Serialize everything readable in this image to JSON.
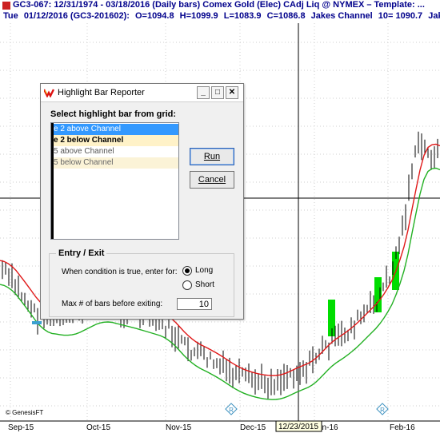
{
  "header": {
    "title": "GC3-067:  12/31/1974 - 03/18/2016  (Daily bars)   Comex Gold (Elec) CAdj Liq @ NYMEX  –  Template: ...",
    "info": [
      "Tue",
      "01/12/2016 (GC3-201602):",
      "O=1094.8",
      "H=1099.9",
      "L=1083.9",
      "C=1086.8",
      "Jakes Channel",
      "10= 1090.7",
      "Jake"
    ]
  },
  "chart": {
    "x_labels": [
      "Sep-15",
      "Oct-15",
      "Nov-15",
      "Dec-15",
      "Jan-16",
      "Feb-16"
    ],
    "cursor_date": "12/23/2015",
    "watermark": "© GenesisFT",
    "diamond_glyph": "R",
    "colors": {
      "red_line": "#e01818",
      "green_line": "#22b022",
      "highlight": "#00dd00",
      "bars": "#000000"
    }
  },
  "dialog": {
    "title": "Highlight Bar Reporter",
    "select_label": "Select highlight bar from grid:",
    "list_items": [
      {
        "label": "e 2 above Channel",
        "state": "selected"
      },
      {
        "label": "e 2 below Channel",
        "state": "bold"
      },
      {
        "label": "5 above Channel",
        "state": "normal"
      },
      {
        "label": "5 below Channel",
        "state": "shaded"
      }
    ],
    "run_label": "Run",
    "cancel_label": "Cancel",
    "group_title": "Entry / Exit",
    "condition_label": "When condition is true, enter for:",
    "long_label": "Long",
    "short_label": "Short",
    "selected_direction": "Long",
    "maxbars_label": "Max # of bars before exiting:",
    "maxbars_value": "10"
  }
}
